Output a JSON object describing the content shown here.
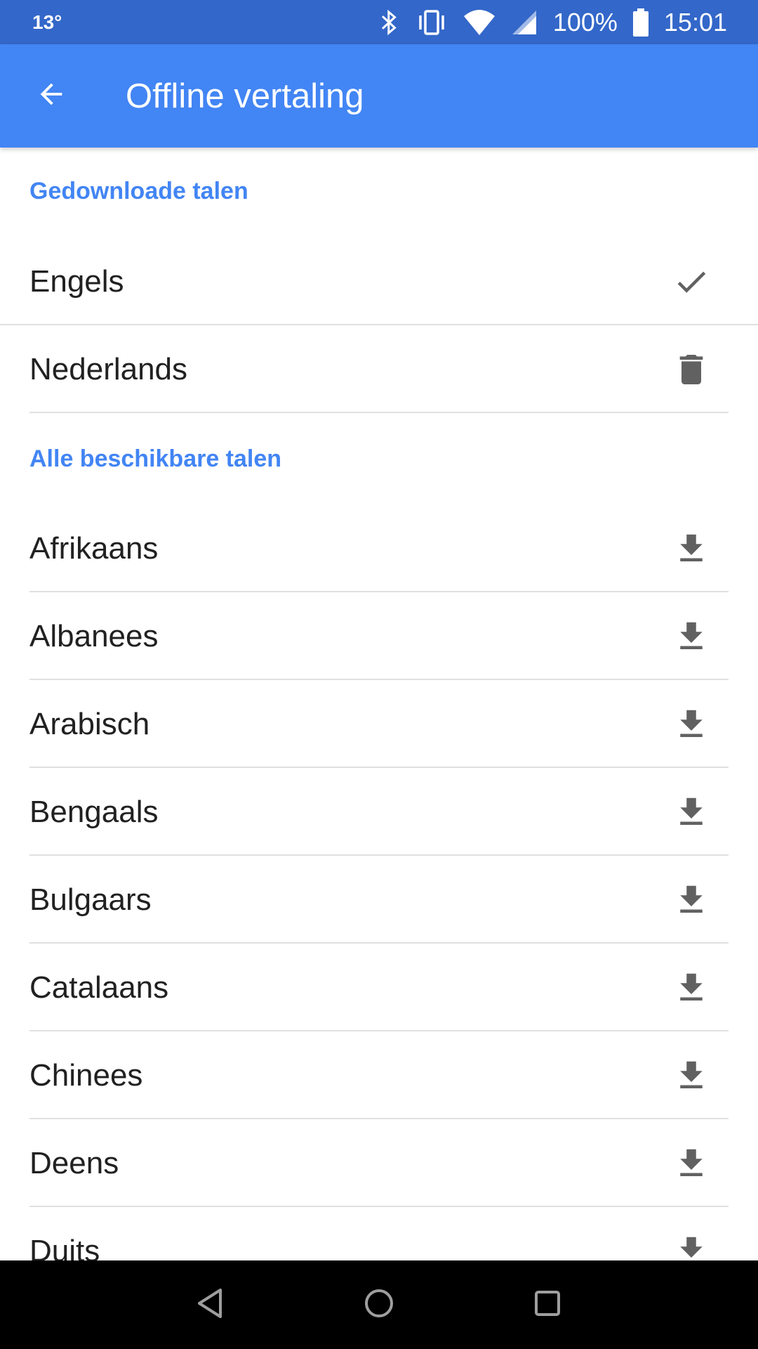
{
  "status_bar": {
    "temperature": "13°",
    "battery": "100%",
    "time": "15:01"
  },
  "app_bar": {
    "title": "Offline vertaling",
    "back_icon": "arrow-back-icon"
  },
  "sections": {
    "downloaded": {
      "title": "Gedownloade talen",
      "items": [
        {
          "label": "Engels",
          "icon": "check-icon"
        },
        {
          "label": "Nederlands",
          "icon": "delete-icon"
        }
      ]
    },
    "available": {
      "title": "Alle beschikbare talen",
      "items": [
        {
          "label": "Afrikaans",
          "icon": "download-icon"
        },
        {
          "label": "Albanees",
          "icon": "download-icon"
        },
        {
          "label": "Arabisch",
          "icon": "download-icon"
        },
        {
          "label": "Bengaals",
          "icon": "download-icon"
        },
        {
          "label": "Bulgaars",
          "icon": "download-icon"
        },
        {
          "label": "Catalaans",
          "icon": "download-icon"
        },
        {
          "label": "Chinees",
          "icon": "download-icon"
        },
        {
          "label": "Deens",
          "icon": "download-icon"
        },
        {
          "label": "Duits",
          "icon": "download-icon"
        }
      ]
    }
  },
  "colors": {
    "status_bar": "#3367c9",
    "app_bar": "#4285f4",
    "accent": "#4285f4",
    "icon": "#616161"
  }
}
